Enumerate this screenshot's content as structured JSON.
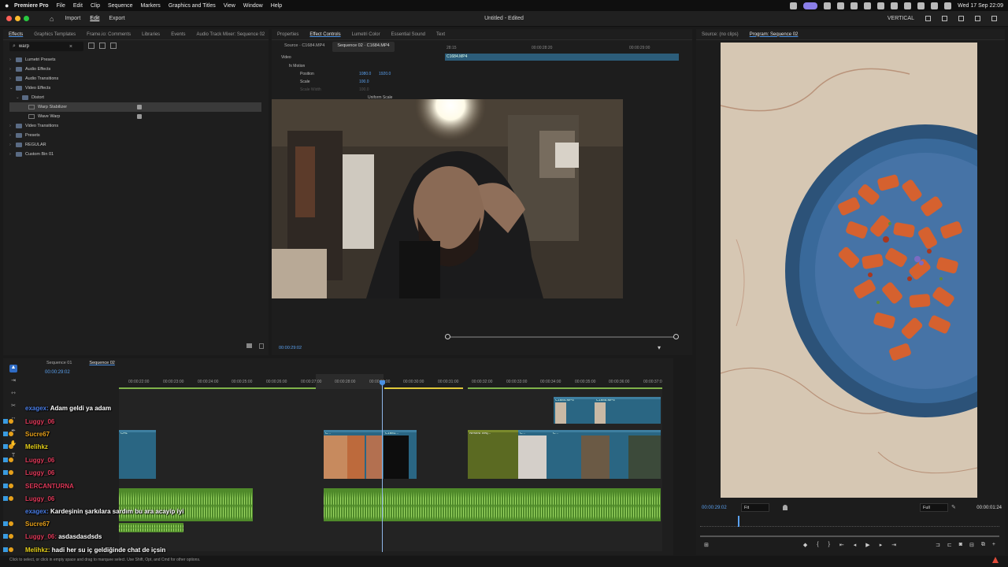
{
  "menubar": {
    "app": "Premiere Pro",
    "items": [
      "File",
      "Edit",
      "Clip",
      "Sequence",
      "Markers",
      "Graphics and Titles",
      "View",
      "Window",
      "Help"
    ],
    "clock": "Wed 17 Sep  22:09"
  },
  "titlebar": {
    "nav": [
      "Import",
      "Edit",
      "Export"
    ],
    "active_nav": "Edit",
    "title": "Untitled - Edited",
    "right_label": "VERTICAL"
  },
  "effects_panel": {
    "tabs": [
      "Effects",
      "Graphics Templates",
      "Frame.io: Comments",
      "Libraries",
      "Events",
      "Audio Track Mixer: Sequence 02"
    ],
    "search_value": "warp",
    "tree": [
      {
        "label": "Lumetri Presets",
        "level": 0,
        "open": false
      },
      {
        "label": "Audio Effects",
        "level": 0,
        "open": false
      },
      {
        "label": "Audio Transitions",
        "level": 0,
        "open": false
      },
      {
        "label": "Video Effects",
        "level": 0,
        "open": true
      },
      {
        "label": "Distort",
        "level": 1,
        "open": true
      },
      {
        "label": "Warp Stabilizer",
        "level": 2,
        "selected": true
      },
      {
        "label": "Wave Warp",
        "level": 2
      },
      {
        "label": "Video Transitions",
        "level": 0,
        "open": false
      },
      {
        "label": "Presets",
        "level": 0,
        "open": false
      },
      {
        "label": "REGULAR",
        "level": 0,
        "open": false
      },
      {
        "label": "Custom Bin 01",
        "level": 0,
        "open": false
      }
    ]
  },
  "effect_controls": {
    "tabs": [
      "Properties",
      "Effect Controls",
      "Lumetri Color",
      "Essential Sound",
      "Text"
    ],
    "source_tab": "Source · C1684.MP4",
    "sequence_tab": "Sequence 02 · C1684.MP4",
    "section": "Video",
    "motion": "Motion",
    "position_label": "Position",
    "position_x": "1080.0",
    "position_y": "1920.0",
    "scale_label": "Scale",
    "scale_value": "100.0",
    "scale_width_label": "Scale Width",
    "scale_width_value": "100.0",
    "uniform_label": "Uniform Scale",
    "ruler": [
      "28:15",
      "00:00:28:20",
      "00:00:29:00"
    ],
    "clip_label": "C1684.MP4",
    "timecode": "00:00:29:02"
  },
  "program": {
    "tabs": [
      "Source: (no clips)",
      "Program: Sequence 02"
    ],
    "timecode": "00:00:29:02",
    "fit": "Fit",
    "full": "Full",
    "duration": "00:00:01:24"
  },
  "timeline": {
    "tabs": [
      "Sequence 01",
      "Sequence 02"
    ],
    "timecode": "00:00:29:02",
    "ruler": [
      "00:00:22:00",
      "00:00:23:00",
      "00:00:24:00",
      "00:00:25:00",
      "00:00:26:00",
      "00:00:27:00",
      "00:00:28:00",
      "00:00:29:00",
      "00:00:30:00",
      "00:00:31:00",
      "00:00:32:00",
      "00:00:33:00",
      "00:00:34:00",
      "00:00:35:00",
      "00:00:36:00",
      "00:00:37:0"
    ],
    "clips_v2": [
      "C1684.MP4",
      "C1685.MP4"
    ],
    "clips_v1": [
      "CHL",
      "C...",
      "C1681...",
      "Nested Seq...",
      "C...",
      "C..."
    ]
  },
  "chat": [
    {
      "user": "exagex",
      "color": "#4a7ee8",
      "message": "Adam geldi ya adam"
    },
    {
      "user": "Luggy_06",
      "color": "#e03a5a",
      "message": ""
    },
    {
      "user": "Sucre67",
      "color": "#e6a01a",
      "message": ""
    },
    {
      "user": "Melihkz",
      "color": "#e6d01a",
      "message": ""
    },
    {
      "user": "Luggy_06",
      "color": "#e03a5a",
      "message": ""
    },
    {
      "user": "Luggy_06",
      "color": "#e03a5a",
      "message": ""
    },
    {
      "user": "SERCANTURNA",
      "color": "#e03a5a",
      "message": ""
    },
    {
      "user": "Luggy_06",
      "color": "#e03a5a",
      "message": ""
    },
    {
      "user": "exagex",
      "color": "#4a7ee8",
      "message": "Kardeşinin şarkılara sardım bu ara acayip iyi"
    },
    {
      "user": "Sucre67",
      "color": "#e6a01a",
      "message": ""
    },
    {
      "user": "Luggy_06",
      "color": "#e03a5a",
      "message": "asdasdasdsds"
    },
    {
      "user": "Melihkz",
      "color": "#e6d01a",
      "message": "hadi her su iç geldiğinde chat de içsin"
    }
  ],
  "status": "Click to select, or click in empty space and drag to marquee select. Use Shift, Opt, and Cmd for other options."
}
